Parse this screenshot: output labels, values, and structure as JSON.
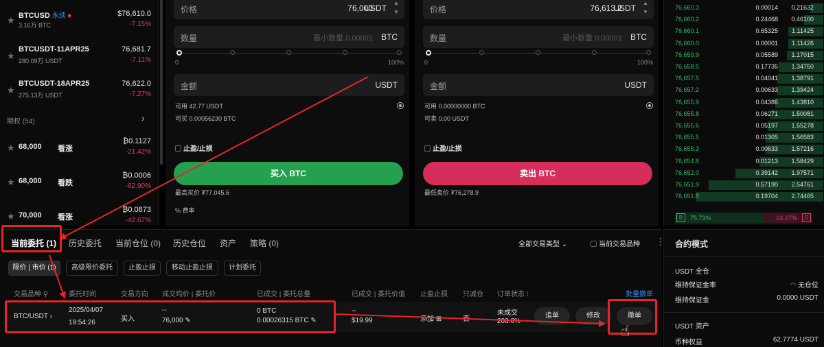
{
  "markets": [
    {
      "symbol": "BTCUSD",
      "tag": "永续",
      "volume": "3.16万 BTC",
      "price": "$76,610.0",
      "change": "-7.15%"
    },
    {
      "symbol": "BTCUSDT-11APR25",
      "volume": "280.09万 USDT",
      "price": "76,681.7",
      "change": "-7.11%"
    },
    {
      "symbol": "BTCUSDT-18APR25",
      "volume": "275.13万 USDT",
      "price": "76,622.0",
      "change": "-7.27%"
    }
  ],
  "options_header": "期权 (54)",
  "options": [
    {
      "strike": "68,000",
      "direction": "看涨",
      "price": "₿0.1127",
      "change": "-21.42%"
    },
    {
      "strike": "68,000",
      "direction": "看跌",
      "price": "₿0.0006",
      "change": "-62.90%"
    },
    {
      "strike": "70,000",
      "direction": "看涨",
      "price": "₿0.0873",
      "change": "-42.67%"
    }
  ],
  "buy": {
    "price_label": "价格",
    "price_value": "76,000",
    "price_unit": "USDT",
    "qty_label": "数量",
    "qty_placeholder": "最小数量 0.00001",
    "qty_unit": "BTC",
    "slider_min": "0",
    "slider_max": "100%",
    "amount_label": "金额",
    "amount_unit": "USDT",
    "available": "可用 42.77 USDT",
    "can_trade": "可买 0.00056230 BTC",
    "tpsl": "止盈/止损",
    "button": "买入 BTC",
    "limit_price": "最高买价 ₮77,045.6",
    "fee": "费率"
  },
  "sell": {
    "price_label": "价格",
    "price_value": "76,613.2",
    "price_unit": "USDT",
    "qty_label": "数量",
    "qty_placeholder": "最小数量 0.00001",
    "qty_unit": "BTC",
    "slider_min": "0",
    "slider_max": "100%",
    "amount_label": "金额",
    "amount_unit": "USDT",
    "available": "可用 0.00000000 BTC",
    "can_trade": "可卖 0.00 USDT",
    "tpsl": "止盈/止损",
    "button": "卖出 BTC",
    "limit_price": "最低卖价 ₮76,278.9"
  },
  "orderbook": [
    {
      "price": "76,660.3",
      "qty": "0.00014",
      "total": "0.21632",
      "depth": 0.08
    },
    {
      "price": "76,660.2",
      "qty": "0.24468",
      "total": "0.46100",
      "depth": 0.12
    },
    {
      "price": "76,660.1",
      "qty": "0.65325",
      "total": "1.11425",
      "depth": 0.22
    },
    {
      "price": "76,660.0",
      "qty": "0.00001",
      "total": "1.11426",
      "depth": 0.22
    },
    {
      "price": "76,659.9",
      "qty": "0.05589",
      "total": "1.17015",
      "depth": 0.23
    },
    {
      "price": "76,658.5",
      "qty": "0.17735",
      "total": "1.34750",
      "depth": 0.28
    },
    {
      "price": "76,657.5",
      "qty": "0.04041",
      "total": "1.38791",
      "depth": 0.29
    },
    {
      "price": "76,657.2",
      "qty": "0.00633",
      "total": "1.39424",
      "depth": 0.29
    },
    {
      "price": "76,655.9",
      "qty": "0.04386",
      "total": "1.43810",
      "depth": 0.3
    },
    {
      "price": "76,655.8",
      "qty": "0.06271",
      "total": "1.50081",
      "depth": 0.33
    },
    {
      "price": "76,655.6",
      "qty": "0.05197",
      "total": "1.55278",
      "depth": 0.35
    },
    {
      "price": "76,655.5",
      "qty": "0.01305",
      "total": "1.56583",
      "depth": 0.36
    },
    {
      "price": "76,655.3",
      "qty": "0.00633",
      "total": "1.57216",
      "depth": 0.36
    },
    {
      "price": "76,654.8",
      "qty": "0.01213",
      "total": "1.58429",
      "depth": 0.4
    },
    {
      "price": "76,652.0",
      "qty": "0.39142",
      "total": "1.97571",
      "depth": 0.55
    },
    {
      "price": "76,651.9",
      "qty": "0.57190",
      "total": "2.54761",
      "depth": 0.72
    },
    {
      "price": "76,651.8",
      "qty": "0.19704",
      "total": "2.74465",
      "depth": 0.8
    }
  ],
  "ratio": {
    "buy_label": "B",
    "buy_pct": "75.73%",
    "sell_pct": "24.27%",
    "sell_label": "S"
  },
  "tabs": [
    "当前委托 (1)",
    "历史委托",
    "当前仓位 (0)",
    "历史仓位",
    "资产",
    "策略 (0)"
  ],
  "type_filter": "全部交易类型",
  "current_only": "当前交易品种",
  "chips": [
    "限价 | 市价 (1)",
    "高级限价委托",
    "止盈止损",
    "移动止盈止损",
    "计划委托"
  ],
  "columns": [
    "交易品种",
    "委托时间",
    "交易方向",
    "成交均价 | 委托价",
    "已成交 | 委托总量",
    "已成交 | 委托价值",
    "止盈止损",
    "只减仓",
    "订单状态"
  ],
  "batch_cancel": "批量撤单",
  "order": {
    "symbol": "BTC/USDT",
    "date": "2025/04/07",
    "time": "19:54:26",
    "side": "买入",
    "avg_price": "--",
    "order_price": "76,000",
    "filled": "0 BTC",
    "total": "0.00026315 BTC",
    "filled_value": "--",
    "order_value": "$19.99",
    "tpsl": "添加",
    "reduce_only": "否",
    "status": "未成交",
    "status_sub": "200.0%",
    "btn_chase": "追单",
    "btn_modify": "修改",
    "btn_cancel": "撤单"
  },
  "right_panel": {
    "title": "合约模式",
    "usdt_cross": "USDT 全仓",
    "maint_rate_label": "维持保证金率",
    "maint_rate_value": "无仓位",
    "maint_margin_label": "维持保证金",
    "maint_margin_value": "0.0000 USDT",
    "assets_title": "USDT 资产",
    "equity_label": "币种权益",
    "equity_value": "62.7774 USDT"
  },
  "colors": {
    "buy": "#24a04f",
    "sell": "#d72d5c",
    "annotation": "#e8242a"
  }
}
